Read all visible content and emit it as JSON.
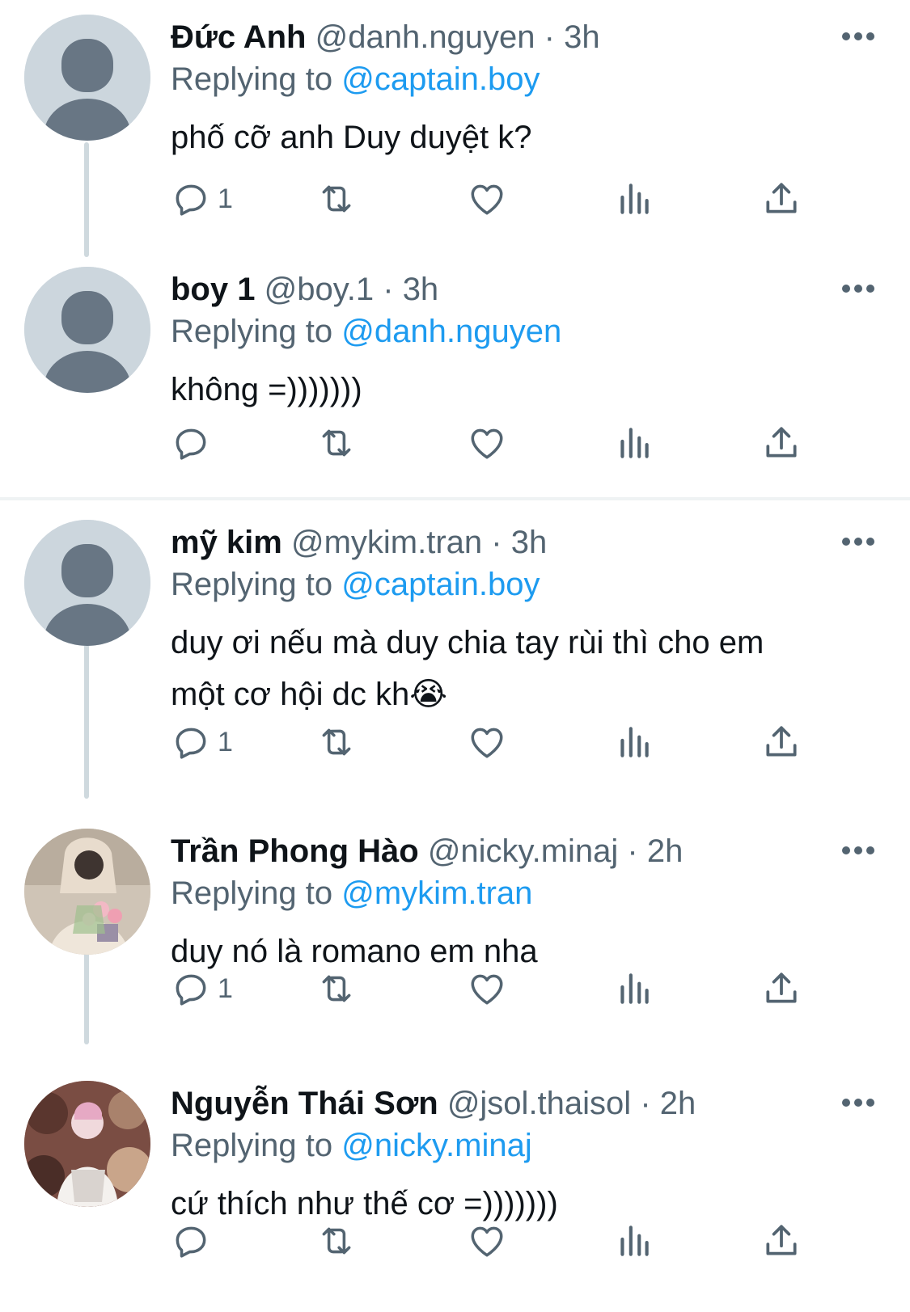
{
  "colors": {
    "accent": "#1d9bf0",
    "secondary_text": "#536471",
    "primary_text": "#0f1419",
    "thread_line": "#cfd9de",
    "default_avatar_bg": "#ccd6dd",
    "default_avatar_fg": "#687684"
  },
  "labels": {
    "replying_to": "Replying to",
    "separator": "·"
  },
  "tweets": [
    {
      "name": "Đức Anh",
      "handle": "@danh.nguyen",
      "time": "3h",
      "replying_to": "@captain.boy",
      "text": "phố cỡ anh Duy duyệt k?",
      "reply_count": "1",
      "avatar": "default-avatar-icon"
    },
    {
      "name": "boy 1",
      "handle": "@boy.1",
      "time": "3h",
      "replying_to": "@danh.nguyen",
      "text": "không =)))))))",
      "reply_count": "",
      "avatar": "default-avatar-icon"
    },
    {
      "name": "mỹ kim",
      "handle": "@mykim.tran",
      "time": "3h",
      "replying_to": "@captain.boy",
      "text_line1": "duy ơi nếu mà duy chia tay rùi thì cho em",
      "text_line2": "một cơ hội dc kh😭",
      "reply_count": "1",
      "avatar": "default-avatar-icon"
    },
    {
      "name": "Trần Phong Hào",
      "handle": "@nicky.minaj",
      "time": "2h",
      "replying_to": "@mykim.tran",
      "text": "duy nó là romano em nha",
      "reply_count": "1",
      "avatar": "profile-photo"
    },
    {
      "name": "Nguyễn Thái Sơn",
      "handle": "@jsol.thaisol",
      "time": "2h",
      "replying_to": "@nicky.minaj",
      "text": "cứ thích như thế cơ =)))))))",
      "reply_count": "",
      "avatar": "profile-photo"
    }
  ]
}
